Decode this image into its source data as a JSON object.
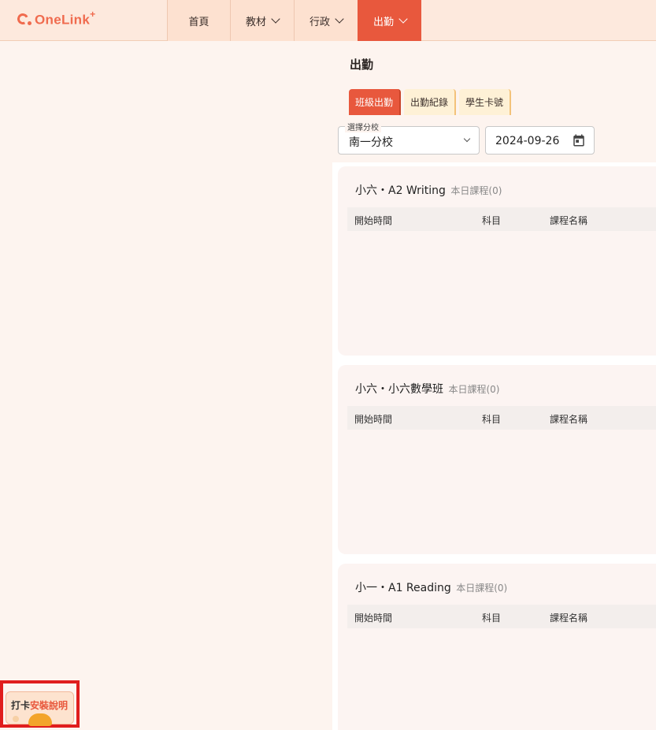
{
  "app": {
    "logo_text": "OneLink",
    "logo_sup": "+"
  },
  "nav": [
    {
      "label": "首頁"
    },
    {
      "label": "教材"
    },
    {
      "label": "行政"
    },
    {
      "label": "出勤"
    }
  ],
  "page": {
    "title": "出勤"
  },
  "tabs": [
    {
      "label": "班級出勤"
    },
    {
      "label": "出勤紀錄"
    },
    {
      "label": "學生卡號"
    }
  ],
  "filters": {
    "branch_label": "選擇分校",
    "branch_value": "南一分校",
    "date_value": "2024-09-26"
  },
  "table_headers": [
    "開始時間",
    "科目",
    "課程名稱"
  ],
  "classes": [
    {
      "title": "小六・A2 Writing",
      "subtitle": "本日課程(0)"
    },
    {
      "title": "小六・小六數學班",
      "subtitle": "本日課程(0)"
    },
    {
      "title": "小一・A1 Reading",
      "subtitle": "本日課程(0)"
    }
  ],
  "widget": {
    "text_a": "打卡",
    "text_b": "安裝說明"
  },
  "colors": {
    "accent": "#e8583d",
    "header_bg": "#fde9dd",
    "tab_bg": "#fef1d6",
    "card_bg": "#fcf4f2"
  }
}
